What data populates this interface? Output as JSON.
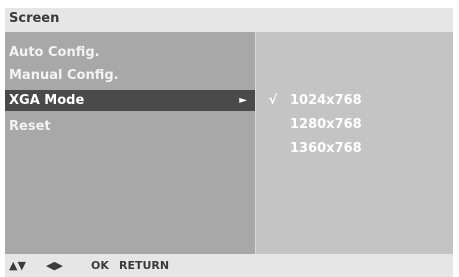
{
  "title": "Screen",
  "menu": [
    {
      "label": "Auto Config."
    },
    {
      "label": "Manual Config."
    },
    {
      "label": "XGA Mode",
      "selected": true,
      "arrow": "►"
    },
    {
      "label": "Reset"
    }
  ],
  "options": [
    {
      "check": "√",
      "value": "1024x768"
    },
    {
      "check": "",
      "value": "1280x768"
    },
    {
      "check": "",
      "value": "1360x768"
    }
  ],
  "footer": {
    "updown": "▲▼",
    "leftright": "◀▶",
    "ok": "OK",
    "return": "RETURN"
  },
  "colors": {
    "title_bg": "#e6e6e6",
    "left_panel": "#a8a8a8",
    "right_panel": "#c4c4c4",
    "selected": "#4a4a4a"
  }
}
